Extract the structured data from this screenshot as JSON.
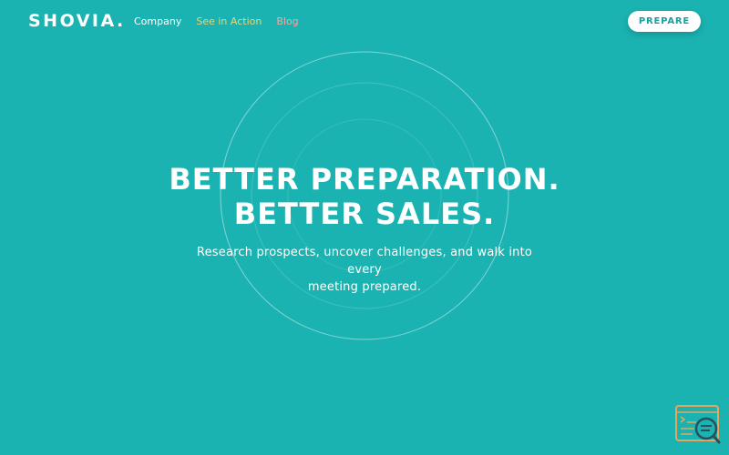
{
  "nav": {
    "logo": "SHOVIA.",
    "links": [
      {
        "label": "Company",
        "color": "#ffffff"
      },
      {
        "label": "See in Action",
        "color": "#f2d36b"
      },
      {
        "label": "Blog",
        "color": "#f3a9a0"
      }
    ],
    "cta_label": "PREPARE"
  },
  "hero": {
    "title_line1": "BETTER PREPARATION.",
    "title_line2": "BETTER SALES.",
    "subtitle_line1": "Research prospects, uncover challenges, and walk into every",
    "subtitle_line2": "meeting prepared."
  },
  "widget": {
    "icon": "search-document-icon"
  },
  "colors": {
    "background": "#1ab3b1",
    "accent_text": "#1a9e9c",
    "widget_orange": "#e9a55a",
    "widget_navy": "#2b4f5a"
  }
}
